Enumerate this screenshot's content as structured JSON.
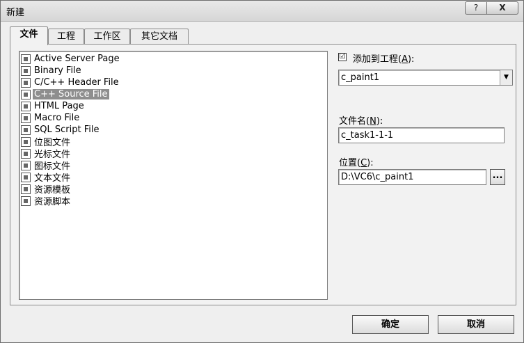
{
  "window": {
    "title": "新建",
    "help_label": "?",
    "close_label": "X"
  },
  "tabs": [
    {
      "label": "文件"
    },
    {
      "label": "工程"
    },
    {
      "label": "工作区"
    },
    {
      "label": "其它文档"
    }
  ],
  "file_types": [
    {
      "label": "Active Server Page",
      "icon": "asp-file-icon"
    },
    {
      "label": "Binary File",
      "icon": "binary-file-icon"
    },
    {
      "label": "C/C++ Header File",
      "icon": "header-file-icon"
    },
    {
      "label": "C++ Source File",
      "icon": "cpp-file-icon",
      "selected": true
    },
    {
      "label": "HTML Page",
      "icon": "html-file-icon"
    },
    {
      "label": "Macro File",
      "icon": "macro-file-icon"
    },
    {
      "label": "SQL Script File",
      "icon": "sql-file-icon"
    },
    {
      "label": "位图文件",
      "icon": "bitmap-file-icon"
    },
    {
      "label": "光标文件",
      "icon": "cursor-file-icon"
    },
    {
      "label": "图标文件",
      "icon": "icon-file-icon"
    },
    {
      "label": "文本文件",
      "icon": "text-file-icon"
    },
    {
      "label": "资源模板",
      "icon": "resource-template-icon"
    },
    {
      "label": "资源脚本",
      "icon": "resource-script-icon"
    }
  ],
  "add_to_project": {
    "checked": true,
    "check_mark": "☑",
    "label_prefix": "添加到工程(",
    "label_key": "A",
    "label_suffix": "):",
    "value": "c_paint1",
    "dropdown_glyph": "▼"
  },
  "file_name": {
    "label_prefix": "文件名(",
    "label_key": "N",
    "label_suffix": "):",
    "value": "c_task1-1-1"
  },
  "location": {
    "label_prefix": "位置(",
    "label_key": "C",
    "label_suffix": "):",
    "value": "D:\\VC6\\c_paint1",
    "browse_label": "..."
  },
  "buttons": {
    "ok": "确定",
    "cancel": "取消"
  }
}
